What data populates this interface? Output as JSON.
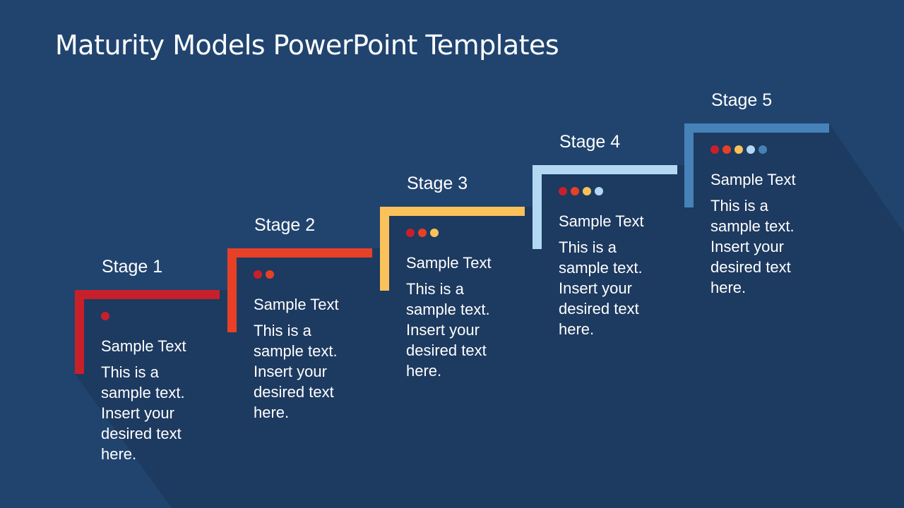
{
  "slide": {
    "title": "Maturity Models PowerPoint Templates",
    "background_color": "#21446f",
    "shadow_color": "#1d3a60"
  },
  "dot_palette": [
    "#c8202a",
    "#e84026",
    "#fbc25a",
    "#b2d8f3",
    "#4681b8"
  ],
  "stages": [
    {
      "label": "Stage 1",
      "color": "#c8202a",
      "dot_count": 1,
      "heading": "Sample Text",
      "body": "This is a sample text. Insert your desired text here."
    },
    {
      "label": "Stage 2",
      "color": "#e84026",
      "dot_count": 2,
      "heading": "Sample Text",
      "body": "This is a sample text. Insert your desired text here."
    },
    {
      "label": "Stage 3",
      "color": "#fbc25a",
      "dot_count": 3,
      "heading": "Sample Text",
      "body": "This is a sample text. Insert your desired text here."
    },
    {
      "label": "Stage 4",
      "color": "#b2d8f3",
      "dot_count": 4,
      "heading": "Sample Text",
      "body": "This is a sample text. Insert your desired text here."
    },
    {
      "label": "Stage 5",
      "color": "#4681b8",
      "dot_count": 5,
      "heading": "Sample Text",
      "body": "This is a sample text. Insert your desired text here."
    }
  ]
}
